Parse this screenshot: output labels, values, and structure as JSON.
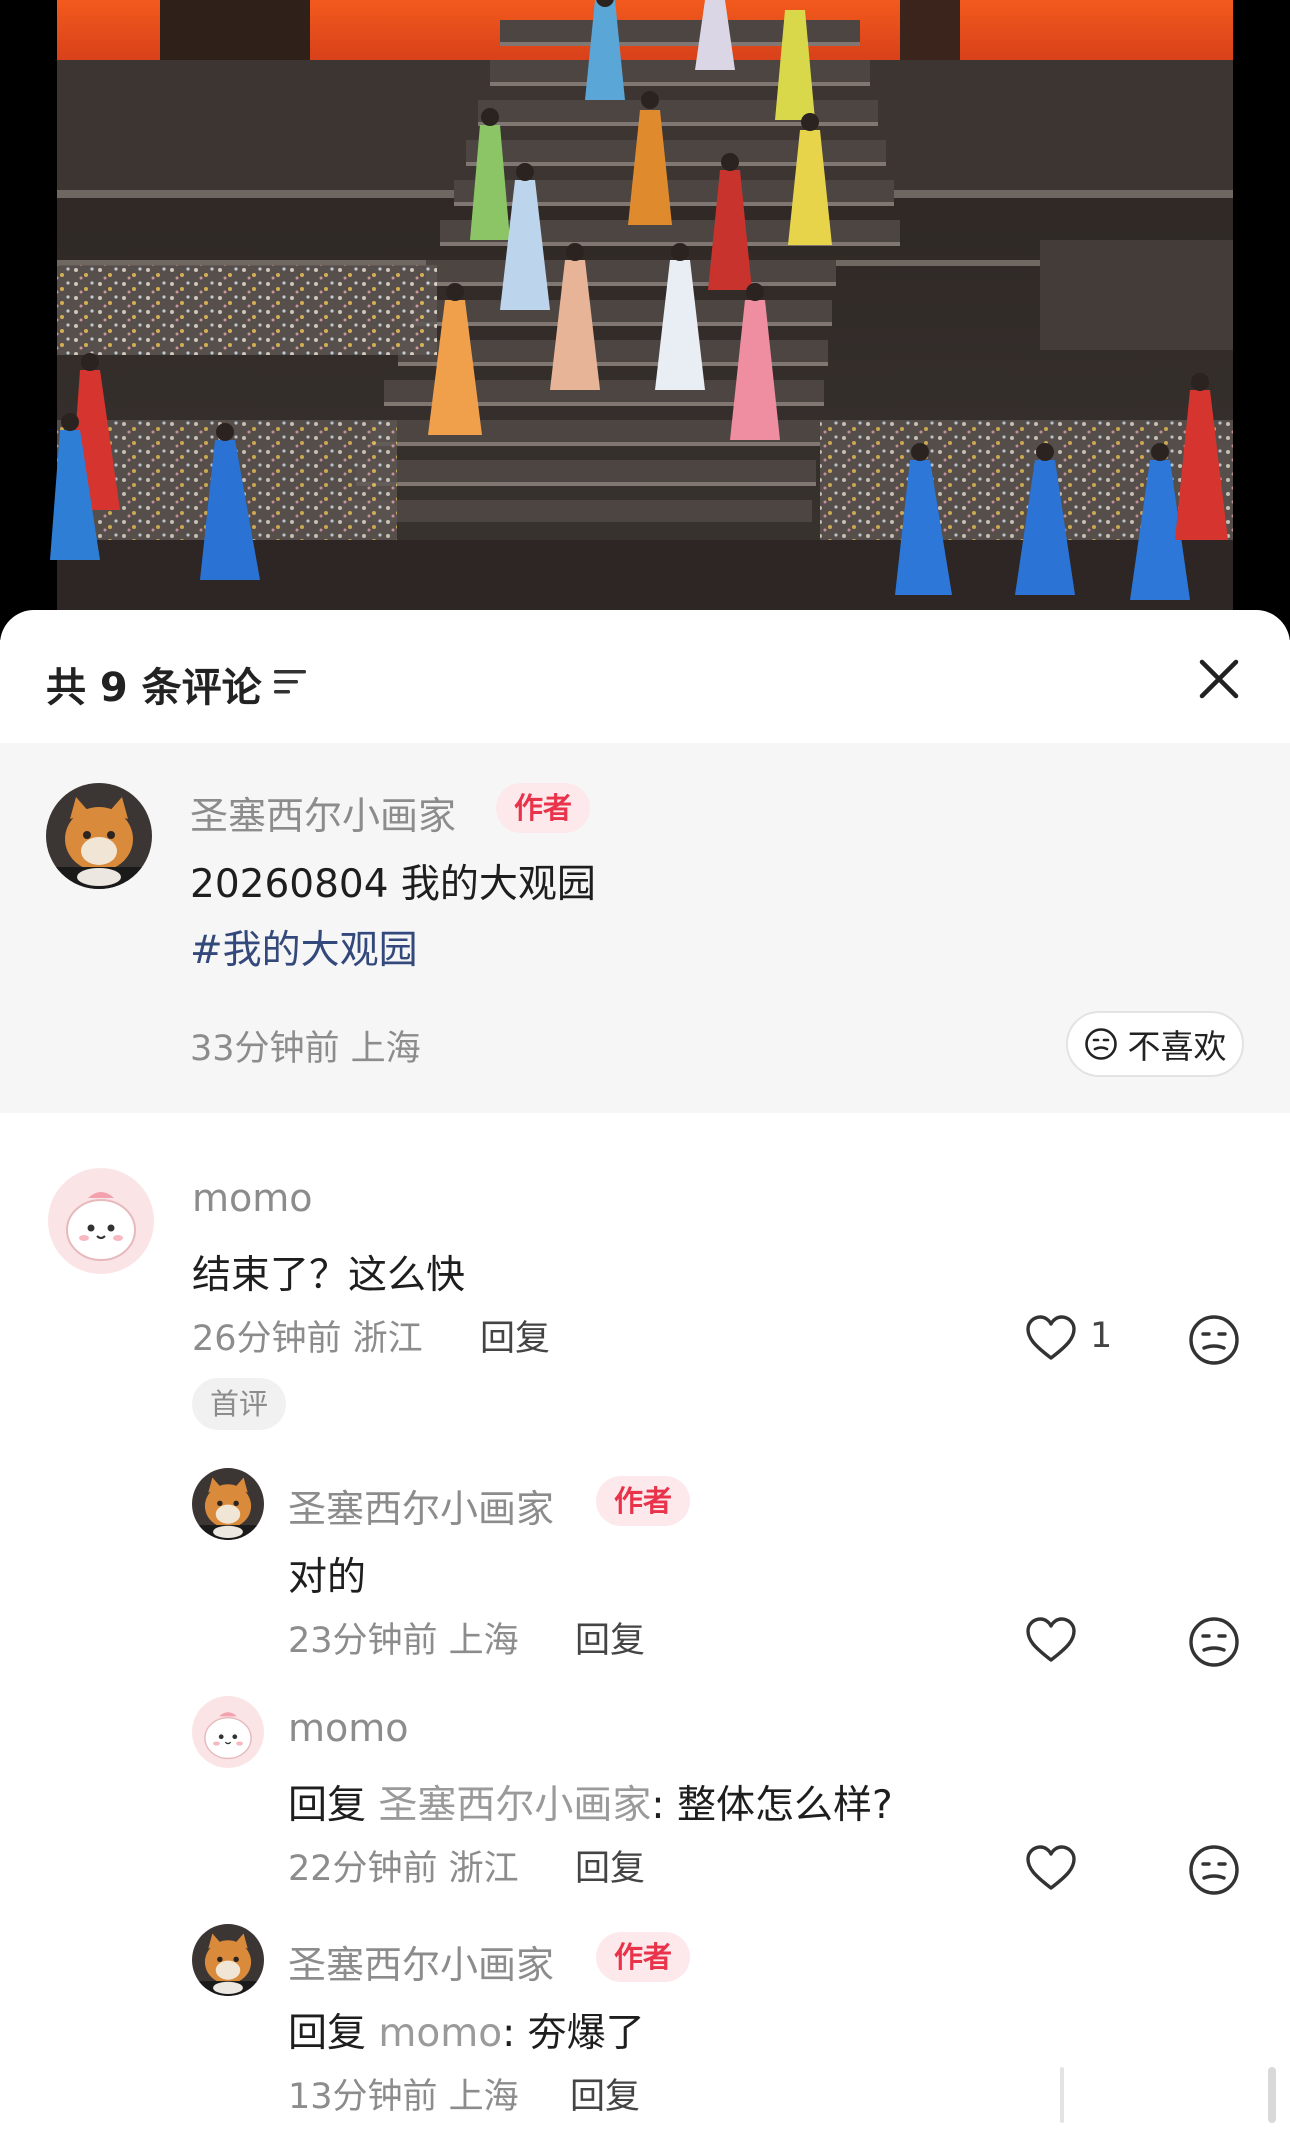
{
  "header": {
    "title": "共 9 条评论",
    "sort_icon": "sort-lines-icon",
    "close_icon": "close-icon"
  },
  "pinned": {
    "username": "圣塞西尔小画家",
    "badge": "作者",
    "text": "20260804 我的大观园",
    "hashtag": "#我的大观园",
    "meta": "33分钟前 上海",
    "dislike_label": "不喜欢"
  },
  "comments": [
    {
      "username": "momo",
      "text": "结束了？这么快",
      "meta": "26分钟前 浙江",
      "reply_label": "回复",
      "like_count": "1",
      "tag": "首评"
    }
  ],
  "replies": [
    {
      "username": "圣塞西尔小画家",
      "badge": "作者",
      "text": "对的",
      "meta": "23分钟前 上海",
      "reply_label": "回复"
    },
    {
      "username": "momo",
      "reply_prefix": "回复 ",
      "mention": "圣塞西尔小画家",
      "text": ": 整体怎么样?",
      "meta": "22分钟前 浙江",
      "reply_label": "回复"
    },
    {
      "username": "圣塞西尔小画家",
      "badge": "作者",
      "reply_prefix": "回复 ",
      "mention": "momo",
      "text": ": 夯爆了",
      "meta": "13分钟前 上海",
      "reply_label": "回复"
    }
  ],
  "colors": {
    "author_badge_bg": "#fde9ec",
    "author_badge_text": "#e8334a",
    "hashtag": "#34497b",
    "pinned_bg": "#f6f6f6"
  }
}
